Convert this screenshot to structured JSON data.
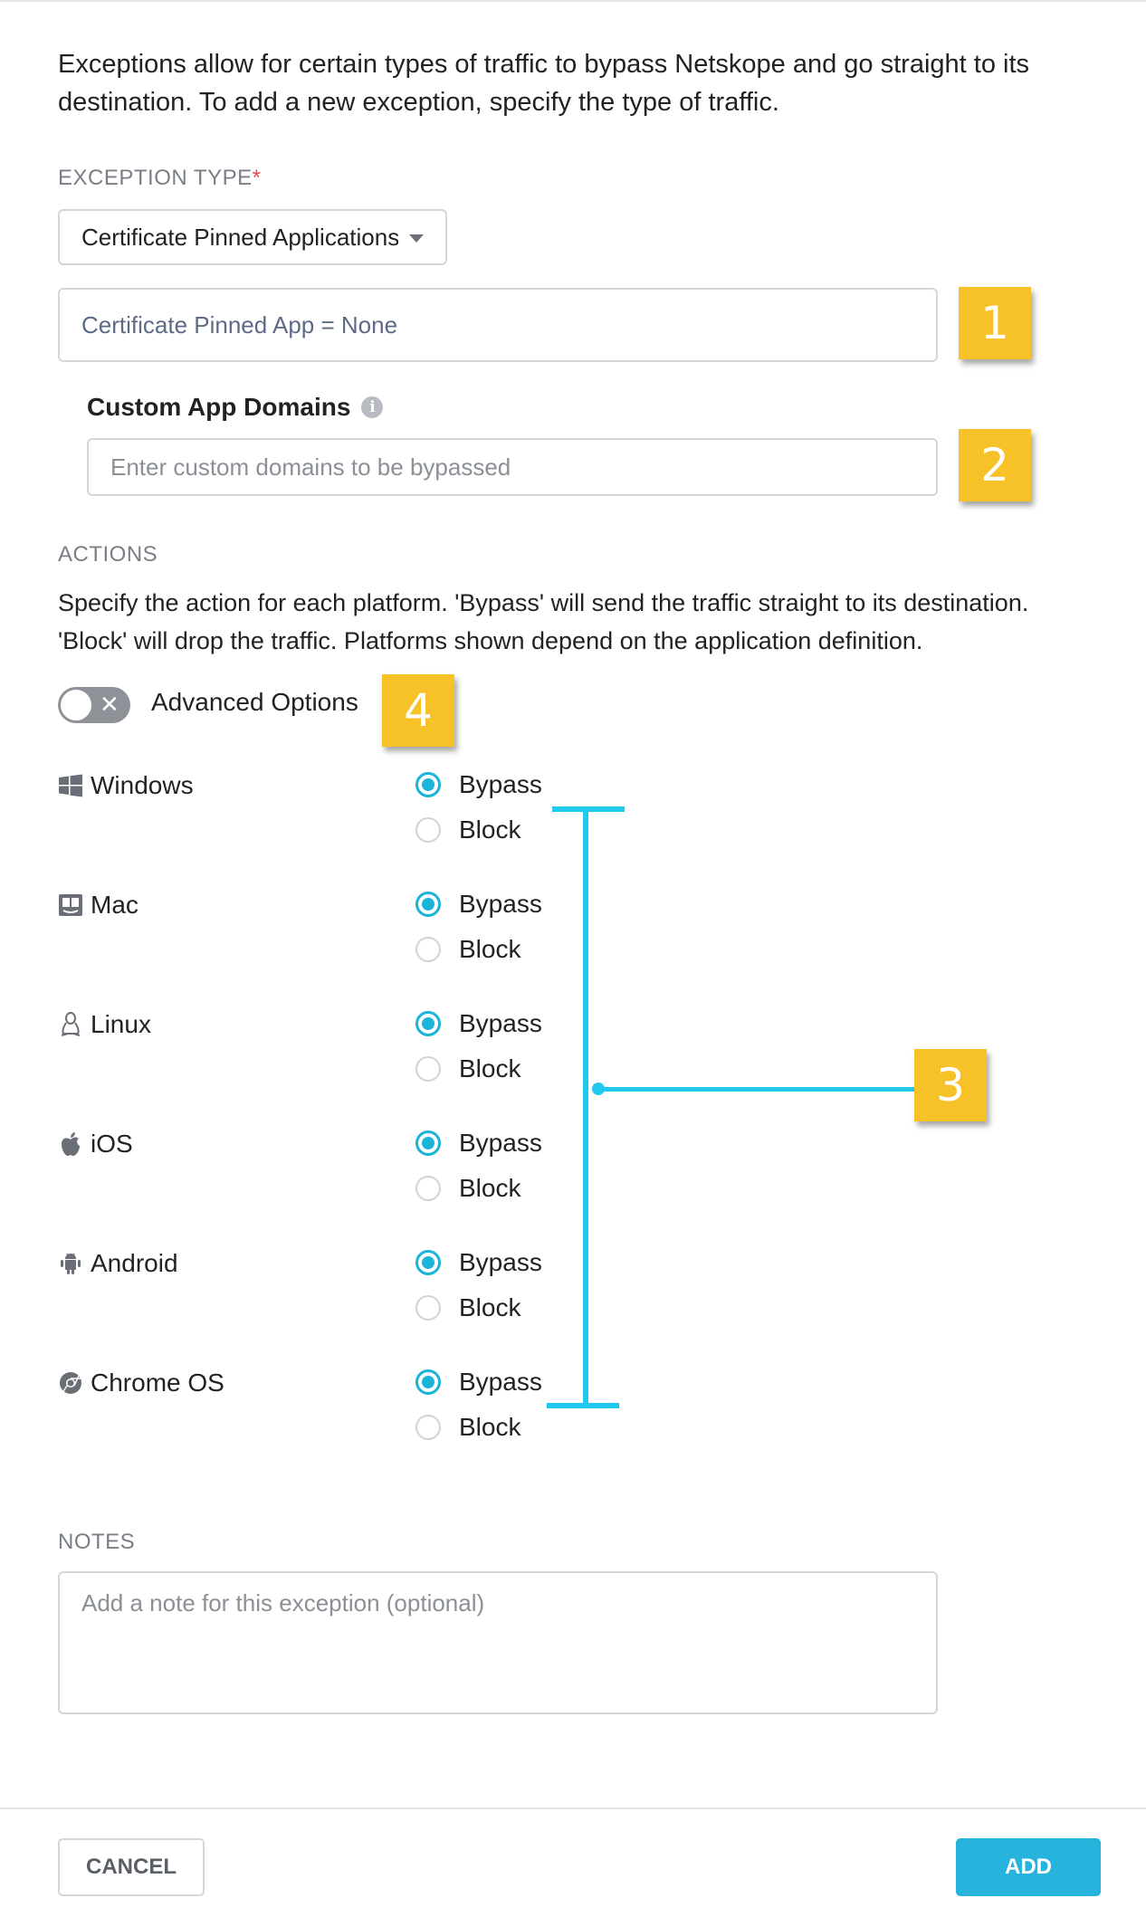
{
  "intro_text": "Exceptions allow for certain types of traffic to bypass Netskope and go straight to its destination. To add a new exception, specify the type of traffic.",
  "exception_type": {
    "label": "EXCEPTION TYPE",
    "required_mark": "*",
    "selected": "Certificate Pinned Applications"
  },
  "pinned_app_field": {
    "value": "Certificate Pinned App = None"
  },
  "custom_domains": {
    "label": "Custom App Domains",
    "placeholder": "Enter custom domains to be bypassed"
  },
  "actions": {
    "label": "ACTIONS",
    "description": "Specify the action for each platform. 'Bypass' will send the traffic straight to its destination. 'Block' will drop the traffic. Platforms shown depend on the application definition.",
    "advanced_options_label": "Advanced Options",
    "advanced_options_on": false
  },
  "platforms": [
    {
      "name": "Windows",
      "icon": "windows-icon",
      "bypass_label": "Bypass",
      "block_label": "Block",
      "selected": "Bypass"
    },
    {
      "name": "Mac",
      "icon": "mac-finder-icon",
      "bypass_label": "Bypass",
      "block_label": "Block",
      "selected": "Bypass"
    },
    {
      "name": "Linux",
      "icon": "linux-penguin-icon",
      "bypass_label": "Bypass",
      "block_label": "Block",
      "selected": "Bypass"
    },
    {
      "name": "iOS",
      "icon": "apple-icon",
      "bypass_label": "Bypass",
      "block_label": "Block",
      "selected": "Bypass"
    },
    {
      "name": "Android",
      "icon": "android-icon",
      "bypass_label": "Bypass",
      "block_label": "Block",
      "selected": "Bypass"
    },
    {
      "name": "Chrome OS",
      "icon": "chrome-icon",
      "bypass_label": "Bypass",
      "block_label": "Block",
      "selected": "Bypass"
    }
  ],
  "notes": {
    "label": "NOTES",
    "placeholder": "Add a note for this exception (optional)"
  },
  "buttons": {
    "cancel": "CANCEL",
    "add": "ADD"
  },
  "annotations": [
    "1",
    "2",
    "3",
    "4"
  ],
  "colors": {
    "accent": "#1bb3d8",
    "badge": "#f7c227",
    "bracket": "#22c9ee"
  }
}
